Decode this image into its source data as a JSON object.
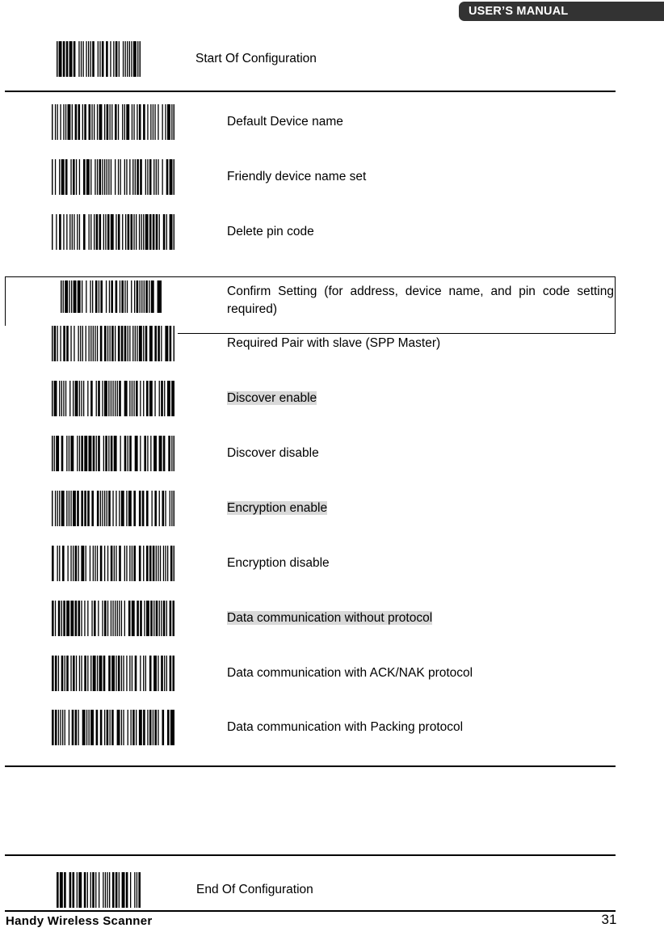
{
  "header": {
    "title": "USER’S MANUAL"
  },
  "sections": {
    "start": {
      "label": "Start Of Configuration",
      "barcode_name": "barcode-start-of-configuration"
    },
    "end": {
      "label": "End Of Configuration",
      "barcode_name": "barcode-end-of-configuration"
    }
  },
  "rows": [
    {
      "id": "default-device-name",
      "label": "Default Device name",
      "highlighted": false,
      "boxed": false
    },
    {
      "id": "friendly-device-name-set",
      "label": "Friendly device name set",
      "highlighted": false,
      "boxed": false
    },
    {
      "id": "delete-pin-code",
      "label": "Delete pin code",
      "highlighted": false,
      "boxed": false
    },
    {
      "id": "confirm-setting",
      "label": "Confirm Setting (for address, device name, and pin code setting required)",
      "highlighted": false,
      "boxed": true
    },
    {
      "id": "required-pair-with-slave-spp-master",
      "label": "Required Pair with slave (SPP Master)",
      "highlighted": false,
      "boxed": false
    },
    {
      "id": "discover-enable",
      "label": "Discover enable",
      "highlighted": true,
      "boxed": false
    },
    {
      "id": "discover-disable",
      "label": "Discover disable",
      "highlighted": false,
      "boxed": false
    },
    {
      "id": "encryption-enable",
      "label": "Encryption enable",
      "highlighted": true,
      "boxed": false
    },
    {
      "id": "encryption-disable",
      "label": "Encryption disable",
      "highlighted": false,
      "boxed": false
    },
    {
      "id": "data-communication-without-protocol",
      "label": "Data communication without protocol",
      "highlighted": true,
      "boxed": false
    },
    {
      "id": "data-communication-with-ack-nak-protocol",
      "label": "Data communication with ACK/NAK protocol",
      "highlighted": false,
      "boxed": false
    },
    {
      "id": "data-communication-with-packing-protocol",
      "label": "Data communication with Packing protocol",
      "highlighted": false,
      "boxed": false
    }
  ],
  "footer": {
    "product": "Handy Wireless Scanner",
    "page_number": "31"
  },
  "colors": {
    "header_background": "#333333",
    "header_text": "#ffffff",
    "highlight": "#d9d9d9",
    "rule": "#000000",
    "page_background": "#ffffff"
  }
}
